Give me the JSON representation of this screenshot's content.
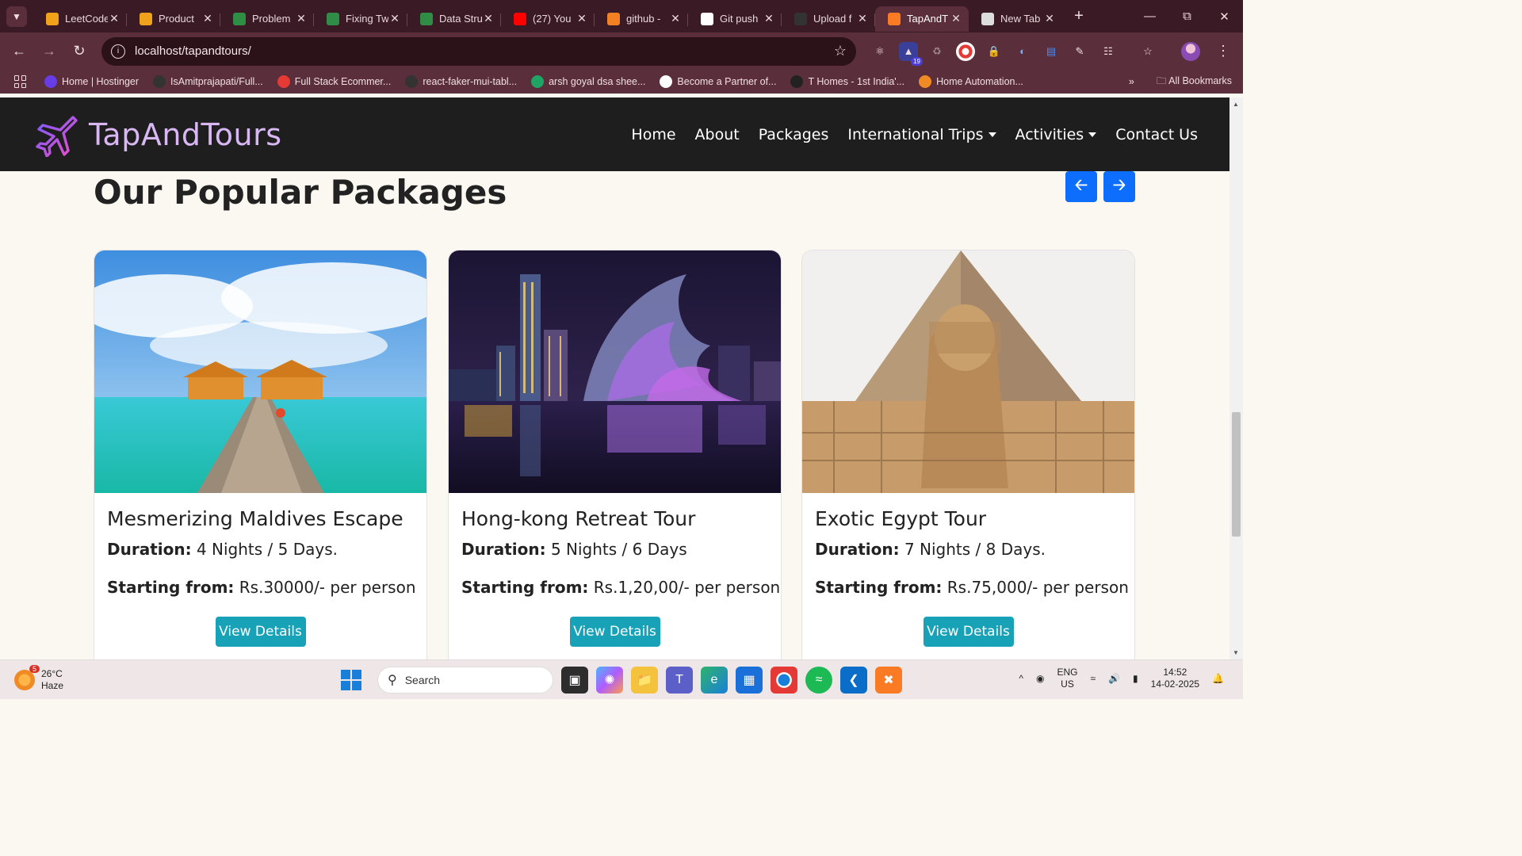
{
  "browser": {
    "tabs": [
      {
        "label": "LeetCode",
        "icon": "leetcode-icon",
        "color": "#f0a31a"
      },
      {
        "label": "Product",
        "icon": "code-icon",
        "color": "#f0a31a"
      },
      {
        "label": "Problem",
        "icon": "gfg-icon",
        "color": "#2f8d46"
      },
      {
        "label": "Fixing Tw",
        "icon": "gfg-icon",
        "color": "#2f8d46"
      },
      {
        "label": "Data Stru",
        "icon": "gfg-icon",
        "color": "#2f8d46"
      },
      {
        "label": "(27) You",
        "icon": "youtube-icon",
        "color": "#ff0000"
      },
      {
        "label": "github -",
        "icon": "stackoverflow-icon",
        "color": "#f48024"
      },
      {
        "label": "Git push",
        "icon": "openai-icon",
        "color": "#ffffff"
      },
      {
        "label": "Upload f",
        "icon": "github-icon",
        "color": "#333333"
      },
      {
        "label": "TapAndT",
        "icon": "xampp-icon",
        "color": "#fb7a24",
        "active": true
      },
      {
        "label": "New Tab",
        "icon": "chrome-icon",
        "color": "#dddddd"
      }
    ],
    "url": "localhost/tapandtours/",
    "extension_badge": "19",
    "bookmarks": [
      {
        "label": "Home | Hostinger",
        "icon": "hostinger-icon",
        "color": "#673de6"
      },
      {
        "label": "IsAmitprajapati/Full...",
        "icon": "github-icon",
        "color": "#333333"
      },
      {
        "label": "Full Stack Ecommer...",
        "icon": "ecommerce-icon",
        "color": "#e53935"
      },
      {
        "label": "react-faker-mui-tabl...",
        "icon": "github-icon",
        "color": "#333333"
      },
      {
        "label": "arsh goyal dsa shee...",
        "icon": "sheets-icon",
        "color": "#1fa463"
      },
      {
        "label": "Become a Partner of...",
        "icon": "partner-icon",
        "color": "#ffffff"
      },
      {
        "label": "T Homes - 1st India'...",
        "icon": "thomes-icon",
        "color": "#222222"
      },
      {
        "label": "Home Automation...",
        "icon": "home-icon",
        "color": "#f08a24"
      }
    ],
    "all_bookmarks": "All Bookmarks"
  },
  "site": {
    "brand": "TapAndTours",
    "nav": [
      {
        "label": "Home",
        "dropdown": false
      },
      {
        "label": "About",
        "dropdown": false
      },
      {
        "label": "Packages",
        "dropdown": false
      },
      {
        "label": "International Trips",
        "dropdown": true
      },
      {
        "label": "Activities",
        "dropdown": true
      },
      {
        "label": "Contact Us",
        "dropdown": false
      }
    ],
    "section_title": "Our Popular Packages",
    "cards": [
      {
        "title": "Mesmerizing Maldives Escape",
        "duration_label": "Duration:",
        "duration": "4 Nights / 5 Days.",
        "price_label": "Starting from:",
        "price": "Rs.30000/- per person",
        "button": "View Details"
      },
      {
        "title": "Hong-kong Retreat Tour",
        "duration_label": "Duration:",
        "duration": "5 Nights / 6 Days",
        "price_label": "Starting from:",
        "price": "Rs.1,20,00/- per person",
        "button": "View Details"
      },
      {
        "title": "Exotic Egypt Tour",
        "duration_label": "Duration:",
        "duration": "7 Nights / 8 Days.",
        "price_label": "Starting from:",
        "price": "Rs.75,000/- per person",
        "button": "View Details"
      }
    ],
    "colors": {
      "navbar": "#1e1e1e",
      "brand": "#d9b7f3",
      "primary": "#0d6efd",
      "info": "#17a2b8",
      "page_bg": "#fbf7f1"
    }
  },
  "taskbar": {
    "weather_temp": "26°C",
    "weather_desc": "Haze",
    "weather_badge": "5",
    "search_placeholder": "Search",
    "lang_line1": "ENG",
    "lang_line2": "US",
    "time": "14:52",
    "date": "14-02-2025"
  }
}
